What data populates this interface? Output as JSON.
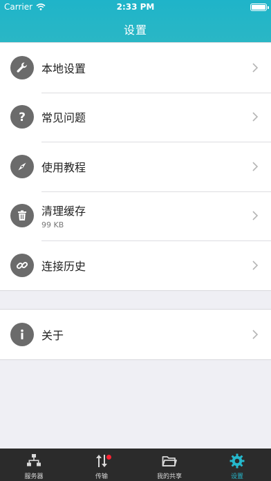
{
  "status_bar": {
    "carrier": "Carrier",
    "time": "2:33 PM"
  },
  "header": {
    "title": "设置"
  },
  "settings": {
    "items": [
      {
        "label": "本地设置",
        "icon": "wrench-icon"
      },
      {
        "label": "常见问题",
        "icon": "question-icon"
      },
      {
        "label": "使用教程",
        "icon": "compass-icon"
      },
      {
        "label": "清理缓存",
        "sub": "99 KB",
        "icon": "trash-icon"
      },
      {
        "label": "连接历史",
        "icon": "link-icon"
      }
    ],
    "about": {
      "label": "关于",
      "icon": "info-icon"
    }
  },
  "tabbar": {
    "items": [
      {
        "label": "服务器",
        "icon": "server-icon"
      },
      {
        "label": "传输",
        "icon": "transfer-icon"
      },
      {
        "label": "我的共享",
        "icon": "folder-icon"
      },
      {
        "label": "设置",
        "icon": "gear-icon"
      }
    ],
    "active_index": 3,
    "accent": "#25b8cc",
    "badge_color": "#ff2233"
  }
}
